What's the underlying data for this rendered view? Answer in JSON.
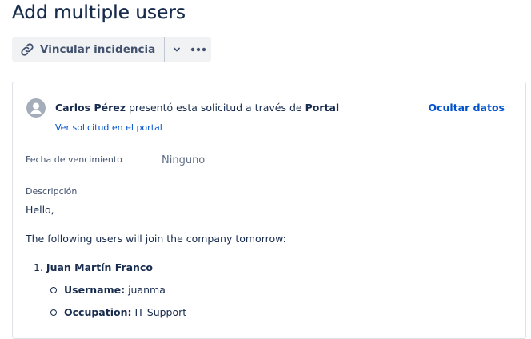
{
  "page": {
    "title": "Add multiple users"
  },
  "toolbar": {
    "link_issue_label": "Vincular incidencia",
    "link_icon": "link-icon",
    "caret_icon": "chevron-down-icon",
    "more_icon": "more-icon"
  },
  "request": {
    "requester_name": "Carlos Pérez",
    "raised_text": "presentó esta solicitud a través de",
    "channel": "Portal",
    "view_portal_label": "Ver solicitud en el portal",
    "hide_details_label": "Ocultar datos",
    "avatar_icon": "user-avatar-icon"
  },
  "fields": {
    "due_date_label": "Fecha de vencimiento",
    "due_date_value": "Ninguno",
    "description_label": "Descripción"
  },
  "description": {
    "greeting": "Hello,",
    "intro": "The following users will join the company tomorrow:",
    "users": [
      {
        "number": "1.",
        "name": "Juan Martín Franco",
        "details": [
          {
            "key": "Username:",
            "value": "juanma"
          },
          {
            "key": "Occupation:",
            "value": "IT Support"
          }
        ]
      }
    ]
  },
  "colors": {
    "link_blue": "#0052cc",
    "text_dark": "#172b4d",
    "text_subtle": "#42526e",
    "button_bg": "#f1f2f4"
  }
}
